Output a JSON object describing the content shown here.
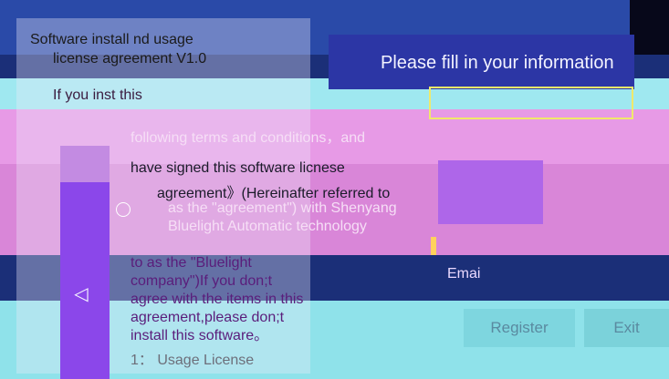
{
  "info_panel": {
    "title": "Please fill in your information",
    "email_label": "Emai"
  },
  "agreement": {
    "title_line1": "Software install",
    "title_line1_suffix": "nd usage",
    "title_line2": "license agreement V1.0",
    "line1": "If you inst",
    "line1b": "this",
    "line3": "following terms and conditions，and",
    "line4": "have signed this",
    "line4b": "software licnese",
    "line5": "agreement》(Hereinafter referred to",
    "line6": "as the \"agreement\") with Shenyang",
    "line7": "Bluelight Automatic technology",
    "paragraph": "to as the \"Bluelight company\")If you don;t agree with the items in this agreement,please don;t install this software。",
    "usage_license": "1： Usage License"
  },
  "buttons": {
    "register": "Register",
    "exit": "Exit"
  }
}
